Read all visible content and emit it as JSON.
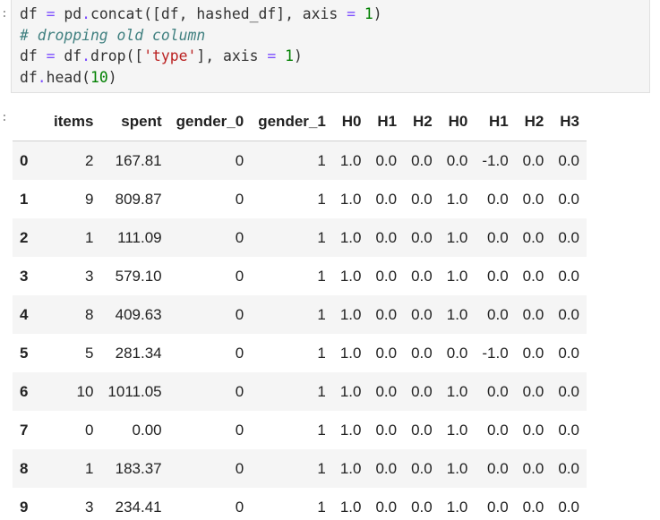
{
  "code_cell": {
    "prompt": ":",
    "lines": [
      "df = pd.concat([df, hashed_df], axis = 1)",
      "# dropping old column",
      "df = df.drop(['type'], axis = 1)",
      "df.head(10)"
    ]
  },
  "output": {
    "prompt": ":",
    "columns": [
      "",
      "items",
      "spent",
      "gender_0",
      "gender_1",
      "H0",
      "H1",
      "H2",
      "H0",
      "H1",
      "H2",
      "H3"
    ],
    "rows": [
      [
        "0",
        "2",
        "167.81",
        "0",
        "1",
        "1.0",
        "0.0",
        "0.0",
        "0.0",
        "-1.0",
        "0.0",
        "0.0"
      ],
      [
        "1",
        "9",
        "809.87",
        "0",
        "1",
        "1.0",
        "0.0",
        "0.0",
        "1.0",
        "0.0",
        "0.0",
        "0.0"
      ],
      [
        "2",
        "1",
        "111.09",
        "0",
        "1",
        "1.0",
        "0.0",
        "0.0",
        "1.0",
        "0.0",
        "0.0",
        "0.0"
      ],
      [
        "3",
        "3",
        "579.10",
        "0",
        "1",
        "1.0",
        "0.0",
        "0.0",
        "1.0",
        "0.0",
        "0.0",
        "0.0"
      ],
      [
        "4",
        "8",
        "409.63",
        "0",
        "1",
        "1.0",
        "0.0",
        "0.0",
        "1.0",
        "0.0",
        "0.0",
        "0.0"
      ],
      [
        "5",
        "5",
        "281.34",
        "0",
        "1",
        "1.0",
        "0.0",
        "0.0",
        "0.0",
        "-1.0",
        "0.0",
        "0.0"
      ],
      [
        "6",
        "10",
        "1011.05",
        "0",
        "1",
        "1.0",
        "0.0",
        "0.0",
        "1.0",
        "0.0",
        "0.0",
        "0.0"
      ],
      [
        "7",
        "0",
        "0.00",
        "0",
        "1",
        "1.0",
        "0.0",
        "0.0",
        "1.0",
        "0.0",
        "0.0",
        "0.0"
      ],
      [
        "8",
        "1",
        "183.37",
        "0",
        "1",
        "1.0",
        "0.0",
        "0.0",
        "1.0",
        "0.0",
        "0.0",
        "0.0"
      ],
      [
        "9",
        "3",
        "234.41",
        "0",
        "1",
        "1.0",
        "0.0",
        "0.0",
        "1.0",
        "0.0",
        "0.0",
        "0.0"
      ]
    ]
  }
}
